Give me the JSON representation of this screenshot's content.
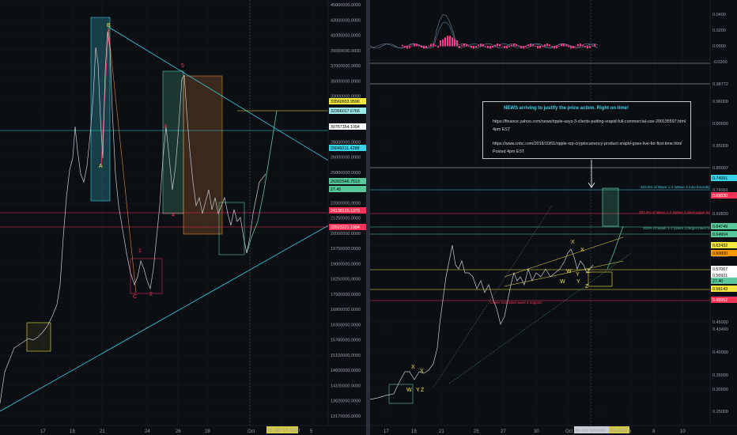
{
  "left_chart": {
    "price_axis": [
      "45000000.0000",
      "43000000.0000",
      "41000000.0000",
      "39000000.0000",
      "37000000.0000",
      "35000000.0000",
      "33000000.0000",
      "31000000.0000",
      "30000000.0000",
      "28000000.0000",
      "26000000.0000",
      "25000000.0000",
      "23000000.0000",
      "22000000.0000",
      "21250000.0000",
      "20500000.0000",
      "19750000.0000",
      "19000000.0000",
      "18250000.0000",
      "17500000.0000",
      "16800000.0000",
      "16300000.0000",
      "15700000.0000",
      "15100000.0000",
      "14600000.0000",
      "14100000.0000",
      "13620000.0000",
      "13170000.0000"
    ],
    "price_tags": [
      {
        "text": "33560933.9596",
        "bg": "#f5e642",
        "fg": "#000000"
      },
      {
        "text": "32366017.6766",
        "bg": "#9fe8e8",
        "fg": "#000000"
      },
      {
        "text": "30767354.1094",
        "bg": "#ffffff",
        "fg": "#000000"
      },
      {
        "text": "29049211.4298",
        "bg": "#3ad2e6",
        "fg": "#000000"
      },
      {
        "text": "26302546.7513",
        "bg": "#58c89b",
        "fg": "#000000"
      },
      {
        "text": "27.45",
        "bg": "#58c89b",
        "fg": "#000000"
      },
      {
        "text": "24138135.1379",
        "bg": "#ff3355",
        "fg": "#ffffff"
      },
      {
        "text": "22923221.1984",
        "bg": "#ff3355",
        "fg": "#ffffff"
      }
    ],
    "date_axis": [
      "17",
      "19",
      "21",
      "24",
      "26",
      "28",
      "Oct",
      "3",
      "5"
    ],
    "crosshair_date": "01 Oct '17  23:00",
    "wave_labels": [
      "B",
      "A",
      "C",
      "1",
      "2",
      "3",
      "4",
      "5"
    ]
  },
  "right_chart": {
    "indicator_axis": [
      "0.0400",
      "0.0200",
      "0.0000",
      "-0.0200"
    ],
    "price_axis": [
      "0.98772",
      "0.96000",
      "0.90000",
      "0.85000",
      "0.80007",
      "0.74991",
      "0.69830",
      "0.64749",
      "0.64904",
      "0.62432",
      "0.60000",
      "0.57067",
      "0.56143",
      "0.49952",
      "0.45000",
      "0.43490",
      "0.40000",
      "0.35000",
      "0.30000",
      "0.25000"
    ],
    "price_tags": [
      {
        "text": "0.74991",
        "bg": "#3ad2e6",
        "fg": "#000000"
      },
      {
        "text": "0.69830",
        "bg": "#ff3355",
        "fg": "#ffffff"
      },
      {
        "text": "0.64749",
        "bg": "#58c89b",
        "fg": "#000000"
      },
      {
        "text": "0.64904",
        "bg": "#58c89b",
        "fg": "#000000"
      },
      {
        "text": "0.62432",
        "bg": "#f5e642",
        "fg": "#000000"
      },
      {
        "text": "0.60000",
        "bg": "#ff9900",
        "fg": "#000000"
      },
      {
        "text": "0.57067",
        "bg": "#ffffff",
        "fg": "#000000"
      },
      {
        "text": "0.56921",
        "bg": "#ffffff",
        "fg": "#000000"
      },
      {
        "text": "27.40",
        "bg": "#58c89b",
        "fg": "#000000"
      },
      {
        "text": "0.56143",
        "bg": "#f5e642",
        "fg": "#000000"
      },
      {
        "text": "0.49952",
        "bg": "#ff3355",
        "fg": "#ffffff"
      }
    ],
    "date_axis": [
      "17",
      "19",
      "21",
      "25",
      "27",
      "30",
      "Oct",
      "4",
      "6",
      "8",
      "10"
    ],
    "crosshair_dates": [
      "01 Oct '18",
      "16:00",
      "18",
      "23:30"
    ],
    "fib_labels": [
      {
        "text": "323.6% of Wave 1-2 (Wave 3 max bounds)",
        "color": "#3ad2e6"
      },
      {
        "text": "261.8% of Wave 1-2 (Wave 3 ideal upper bounds)",
        "color": "#ff3355"
      },
      {
        "text": "200% of Wave 1-2 (wave 3 target lower bounds)",
        "color": "#58c89b"
      },
      {
        "text": "Lower extended wave 4 support",
        "color": "#ff3355"
      }
    ],
    "wave_labels": [
      "X",
      "W",
      "Y",
      "Z",
      "X",
      "W",
      "Y",
      "Z",
      "X",
      "W",
      "Y",
      "X",
      "Z"
    ],
    "news": {
      "title": "NEWS arriving to justify the price action. Right on time!",
      "link1": "https://finance.yahoo.com/news/ripple-says-3-clients-putting-xrapid-full-commercial-use-200135597.html",
      "time1": "4pm EST",
      "link2": "https://www.cnbc.com/2018/10/01/ripple-xrp-cryptocurrency-product-xrapid-goes-live-for-first-time.html",
      "time2": "Posted 4pm EST"
    }
  },
  "colors": {
    "bg": "#0b0e13",
    "candle": "#c9ccd3",
    "grid": "#1c2030",
    "cyan": "#3ad2e6",
    "green": "#58c89b",
    "red": "#ff3355",
    "yellow": "#f5e642",
    "orange": "#e08a3a",
    "pink": "#ff3a8c"
  }
}
